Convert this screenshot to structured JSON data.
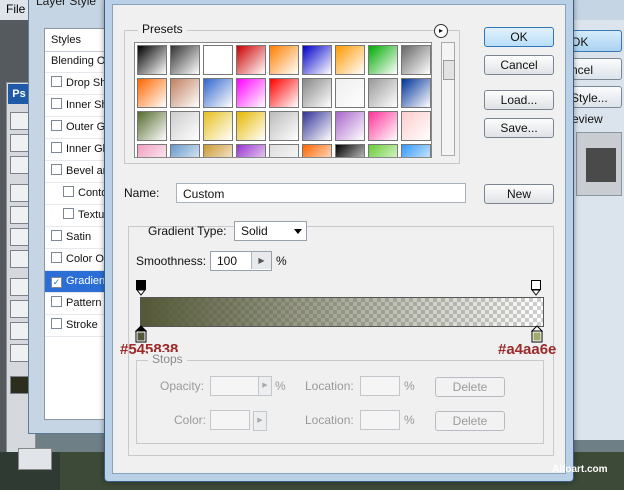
{
  "background": {
    "menu_text": "File",
    "ps_logo": "Ps"
  },
  "layer_style": {
    "title": "Layer Style",
    "styles_header": "Styles",
    "items": [
      {
        "label": "Blending Options",
        "checkbox": false,
        "indent": false,
        "active": false
      },
      {
        "label": "Drop Shadow",
        "checkbox": true,
        "indent": false,
        "active": false
      },
      {
        "label": "Inner Shadow",
        "checkbox": true,
        "indent": false,
        "active": false
      },
      {
        "label": "Outer Glow",
        "checkbox": true,
        "indent": false,
        "active": false
      },
      {
        "label": "Inner Glow",
        "checkbox": true,
        "indent": false,
        "active": false
      },
      {
        "label": "Bevel and Emboss",
        "checkbox": true,
        "indent": false,
        "active": false
      },
      {
        "label": "Contour",
        "checkbox": true,
        "indent": true,
        "active": false
      },
      {
        "label": "Texture",
        "checkbox": true,
        "indent": true,
        "active": false
      },
      {
        "label": "Satin",
        "checkbox": true,
        "indent": false,
        "active": false
      },
      {
        "label": "Color Overlay",
        "checkbox": true,
        "indent": false,
        "active": false
      },
      {
        "label": "Gradient Overlay",
        "checkbox": true,
        "indent": false,
        "active": true
      },
      {
        "label": "Pattern Overlay",
        "checkbox": true,
        "indent": false,
        "active": false
      },
      {
        "label": "Stroke",
        "checkbox": true,
        "indent": false,
        "active": false
      }
    ],
    "buttons": {
      "ok": "OK",
      "cancel": "ncel",
      "new_style": "Style...",
      "preview": "eview"
    }
  },
  "gradient_editor": {
    "presets_label": "Presets",
    "buttons": {
      "ok": "OK",
      "cancel": "Cancel",
      "load": "Load...",
      "save": "Save...",
      "new": "New",
      "delete": "Delete"
    },
    "name_label": "Name:",
    "name_value": "Custom",
    "gradient_type_label": "Gradient Type:",
    "gradient_type_value": "Solid",
    "smoothness_label": "Smoothness:",
    "smoothness_value": "100",
    "smoothness_unit": "%",
    "gradient": {
      "start_color": "#545838",
      "end_color": "#a4aa6e",
      "start_opacity": 1,
      "end_opacity": 0
    },
    "callouts": {
      "left": "#545838",
      "right": "#a4aa6e"
    },
    "stops": {
      "label": "Stops",
      "opacity_label": "Opacity:",
      "location_label": "Location:",
      "color_label": "Color:",
      "percent": "%"
    },
    "presets": [
      [
        "#000000",
        "#333333",
        "#ffffff",
        "#cc0000",
        "#ff7f00",
        "#0000cc",
        "#ff9900",
        "#00aa00",
        "#666666"
      ],
      [
        "#ff6600",
        "#c08060",
        "#3366cc",
        "#ff00ff",
        "#ff0000",
        "#888888",
        "#eeeeee",
        "#999999",
        "#003399"
      ],
      [
        "#556b2f",
        "#cccccc",
        "#e6c020",
        "#e6b800",
        "#bbbbbb",
        "#333399",
        "#aa66cc",
        "#ff3399",
        "#ffcccc"
      ],
      [
        "#f0a0c0",
        "#6699cc",
        "#cc9933",
        "#9933cc",
        "#dddddd",
        "#ff6600",
        "#000000",
        "#66cc33",
        "#3399ff"
      ]
    ]
  },
  "watermark": "Alfoart.com"
}
